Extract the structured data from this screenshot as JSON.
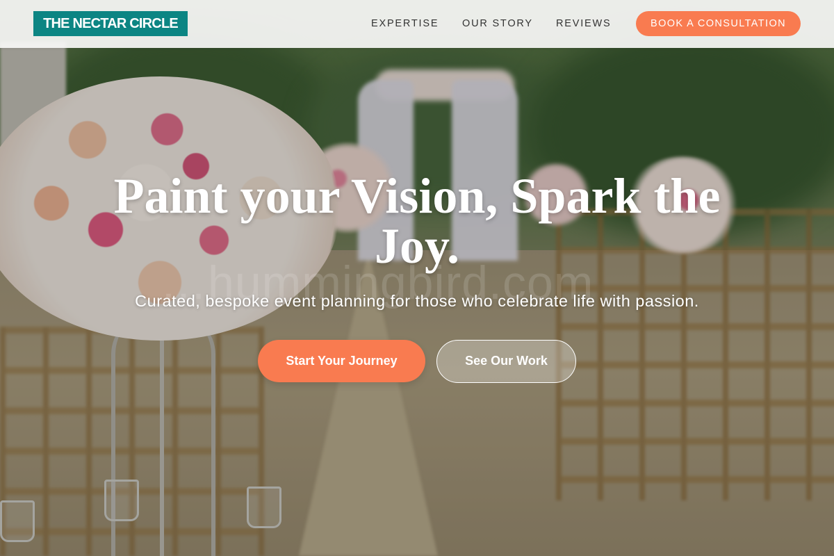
{
  "brand": {
    "name": "THE NECTAR CIRCLE",
    "color": "#0c8583"
  },
  "nav": {
    "links": [
      {
        "label": "EXPERTISE"
      },
      {
        "label": "OUR STORY"
      },
      {
        "label": "REVIEWS"
      }
    ],
    "cta_label": "BOOK A CONSULTATION"
  },
  "hero": {
    "title_line1": "Paint your Vision, Spark the",
    "title_line2": "Joy.",
    "subtitle": "Curated, bespoke event planning for those who celebrate life with passion.",
    "primary_button": "Start Your Journey",
    "secondary_button": "See Our Work",
    "watermark": "…hummingbird.com"
  },
  "colors": {
    "accent": "#f97b50",
    "brand": "#0c8583"
  }
}
